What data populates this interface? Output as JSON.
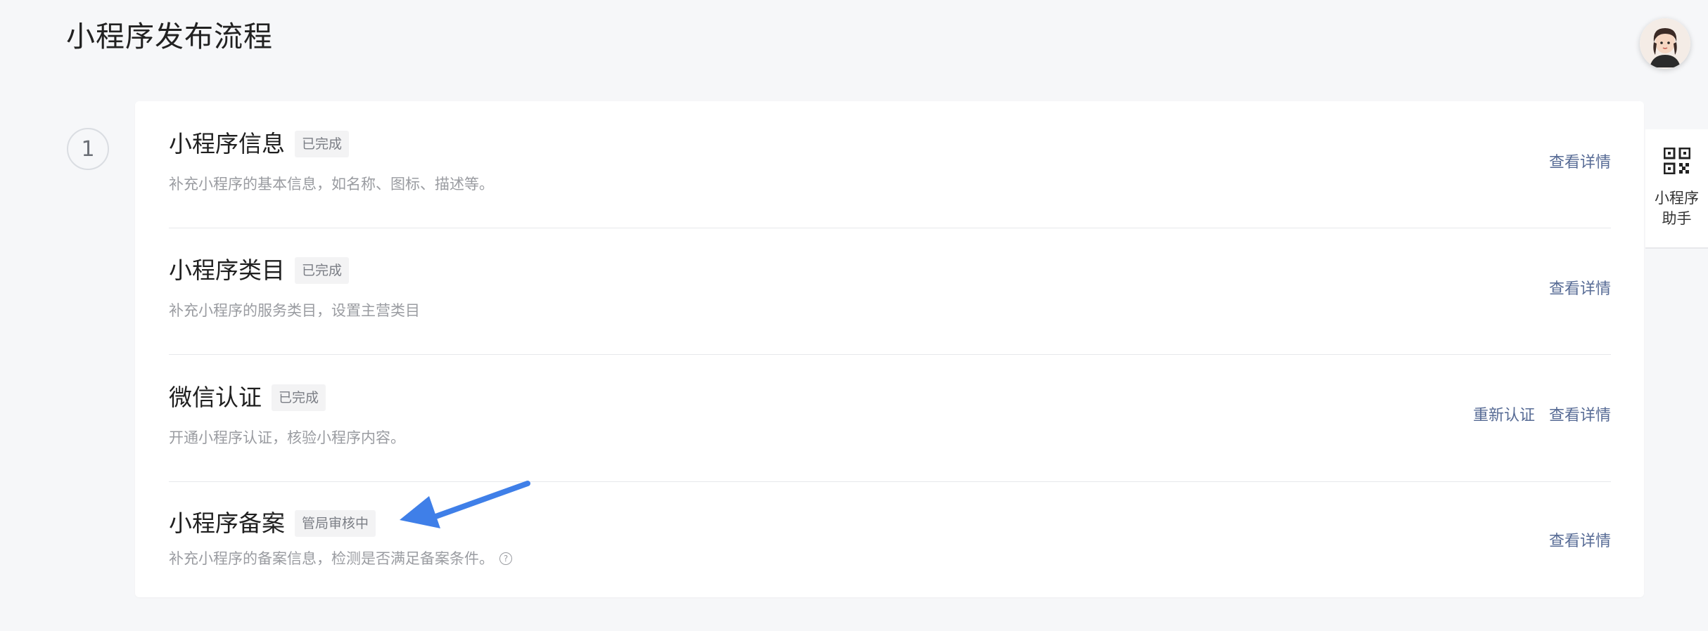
{
  "page": {
    "title": "小程序发布流程"
  },
  "step": {
    "number": "1"
  },
  "items": [
    {
      "title": "小程序信息",
      "badge": "已完成",
      "description": "补充小程序的基本信息，如名称、图标、描述等。",
      "actions": [
        "查看详情"
      ]
    },
    {
      "title": "小程序类目",
      "badge": "已完成",
      "description": "补充小程序的服务类目，设置主营类目",
      "actions": [
        "查看详情"
      ]
    },
    {
      "title": "微信认证",
      "badge": "已完成",
      "description": "开通小程序认证，核验小程序内容。",
      "actions": [
        "重新认证",
        "查看详情"
      ]
    },
    {
      "title": "小程序备案",
      "badge": "管局审核中",
      "description": "补充小程序的备案信息，检测是否满足备案条件。",
      "actions": [
        "查看详情"
      ]
    }
  ],
  "assistant": {
    "label": "小程序助手",
    "icon": "qr-code-icon"
  },
  "help": {
    "glyph": "?"
  },
  "colors": {
    "link": "#576b95",
    "annotation_arrow": "#3f7fe8"
  }
}
